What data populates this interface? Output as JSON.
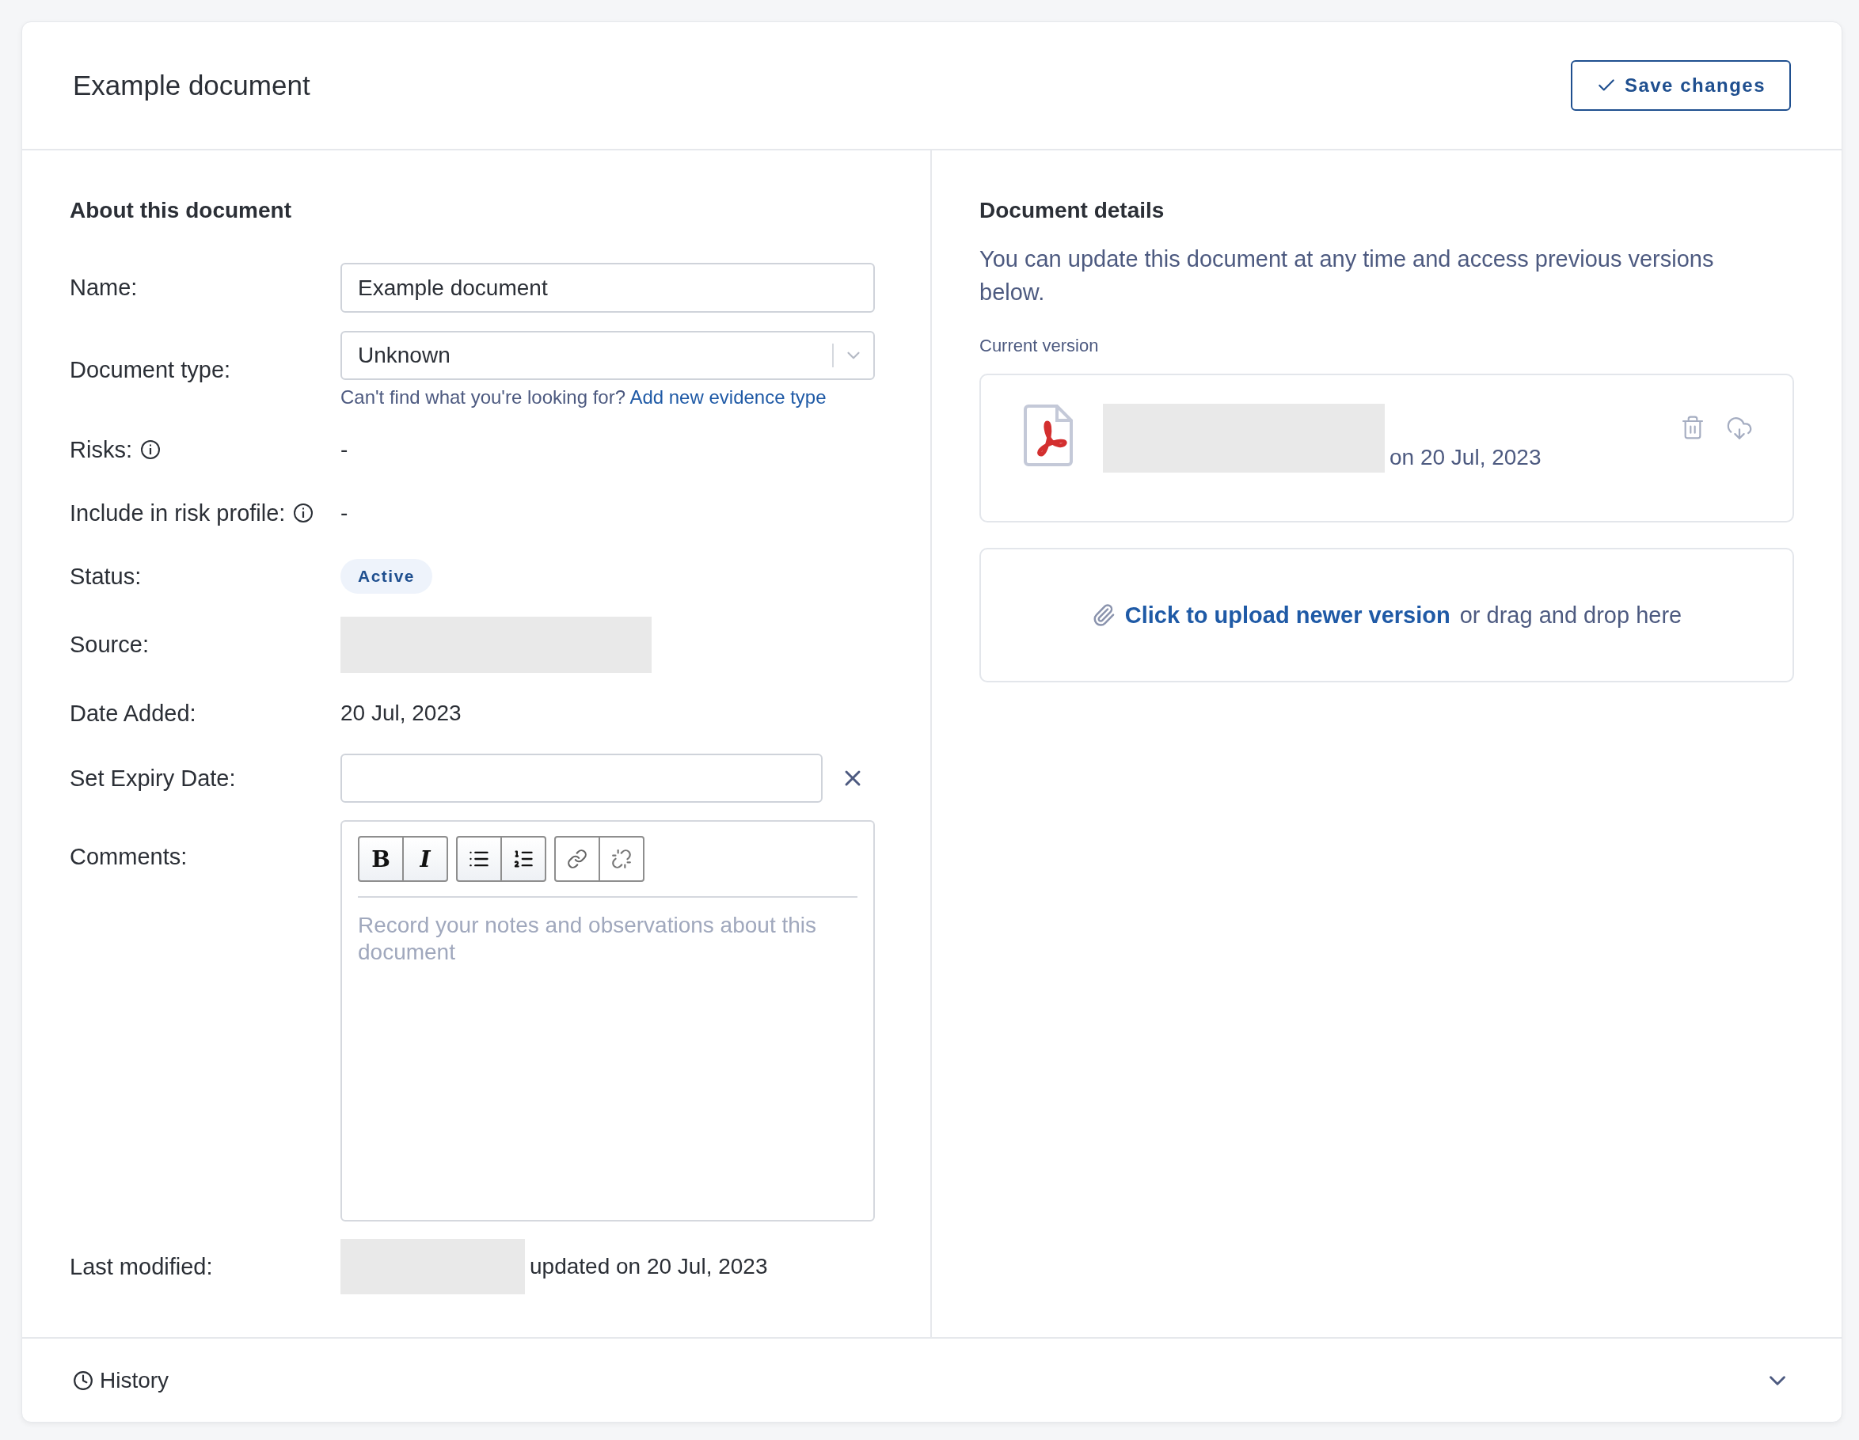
{
  "header": {
    "title": "Example document",
    "save_button": "Save changes"
  },
  "about": {
    "heading": "About this document",
    "rows": [
      {
        "kind": "input",
        "label": "Name:",
        "info": false,
        "value": "Example document"
      },
      {
        "kind": "select",
        "label": "Document type:",
        "info": false,
        "value": "Unknown",
        "help": "Can't find what you're looking for?",
        "help_link": "Add new evidence type"
      },
      {
        "kind": "text",
        "label": "Risks:",
        "info": true,
        "value": "-"
      },
      {
        "kind": "text",
        "label": "Include in risk profile:",
        "info": true,
        "value": "-"
      },
      {
        "kind": "badge",
        "label": "Status:",
        "info": false,
        "value": "Active"
      },
      {
        "kind": "redacted",
        "label": "Source:",
        "info": false
      },
      {
        "kind": "text",
        "label": "Date Added:",
        "info": false,
        "value": "20 Jul, 2023"
      },
      {
        "kind": "date",
        "label": "Set Expiry Date:",
        "info": false
      },
      {
        "kind": "editor",
        "label": "Comments:",
        "info": false,
        "placeholder": "Record your notes and observations about this document",
        "toolbar": [
          {
            "kind": "bold",
            "label": "B"
          },
          {
            "kind": "italic",
            "label": "I"
          },
          {
            "kind": "bullets"
          },
          {
            "kind": "numbers"
          },
          {
            "kind": "link"
          },
          {
            "kind": "unlink"
          }
        ]
      },
      {
        "kind": "modified",
        "label": "Last modified:",
        "info": false,
        "value": "updated on 20 Jul, 2023"
      }
    ]
  },
  "details": {
    "heading": "Document details",
    "intro": "You can update this document at any time and access previous versions below.",
    "current_label": "Current version",
    "current_date": "on 20 Jul, 2023",
    "upload_link": "Click to upload newer version",
    "upload_rest": "or drag and drop here"
  },
  "history": {
    "label": "History",
    "expanded": false
  }
}
